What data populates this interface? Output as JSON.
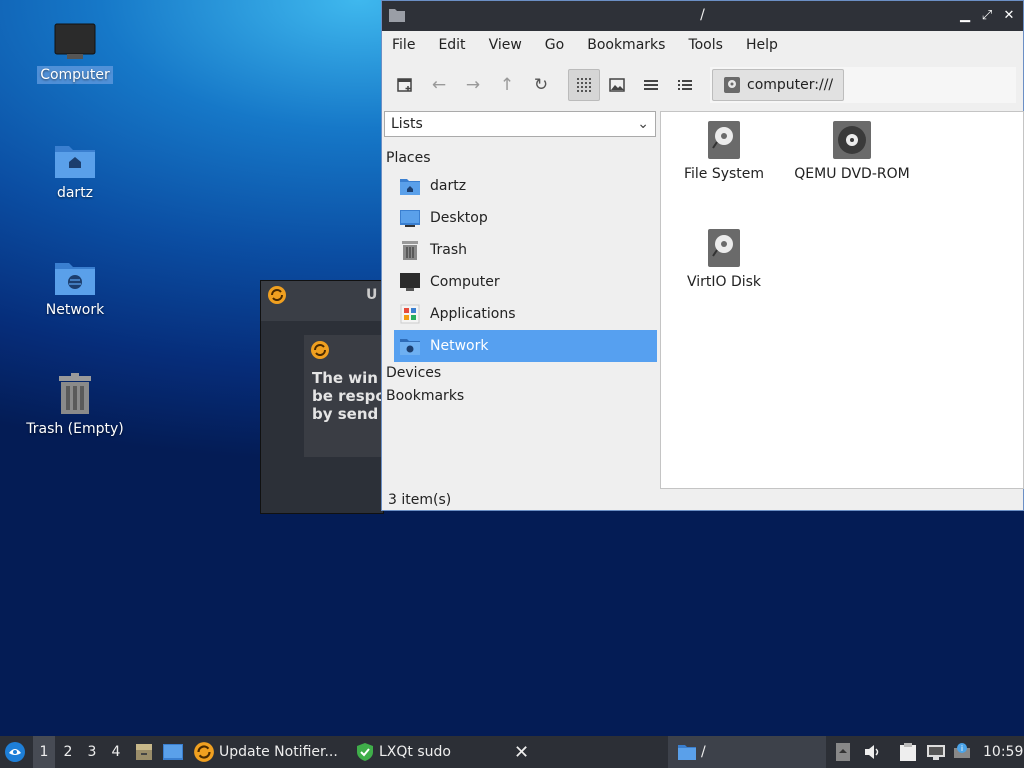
{
  "desktop": {
    "icons": [
      {
        "label": "Computer"
      },
      {
        "label": "dartz"
      },
      {
        "label": "Network"
      },
      {
        "label": "Trash (Empty)"
      }
    ]
  },
  "bg_dialogs": {
    "title_partial": "U",
    "title_partial2": "U",
    "text_lines": [
      "The win",
      "be respo",
      "by send"
    ]
  },
  "window": {
    "title": "/",
    "menu": [
      "File",
      "Edit",
      "View",
      "Go",
      "Bookmarks",
      "Tools",
      "Help"
    ],
    "address": "computer:///",
    "side_combo": "Lists",
    "places_header": "Places",
    "places": [
      {
        "label": "dartz",
        "icon": "home-folder-icon"
      },
      {
        "label": "Desktop",
        "icon": "desktop-icon"
      },
      {
        "label": "Trash",
        "icon": "trash-icon"
      },
      {
        "label": "Computer",
        "icon": "computer-icon"
      },
      {
        "label": "Applications",
        "icon": "applications-icon"
      },
      {
        "label": "Network",
        "icon": "network-folder-icon"
      }
    ],
    "devices_header": "Devices",
    "bookmarks_header": "Bookmarks",
    "items": [
      {
        "label": "File System"
      },
      {
        "label": "QEMU DVD-ROM"
      },
      {
        "label": "VirtIO Disk"
      }
    ],
    "status": "3 item(s)"
  },
  "taskbar": {
    "workspaces": [
      "1",
      "2",
      "3",
      "4"
    ],
    "tasks": [
      {
        "label": "Update Notifier..."
      },
      {
        "label": "LXQt sudo"
      },
      {
        "label": "/"
      }
    ],
    "clock": "10:59"
  },
  "colors": {
    "selection": "#56a0f0",
    "titlebar": "#2e3138",
    "taskbar": "#2c2f36"
  }
}
